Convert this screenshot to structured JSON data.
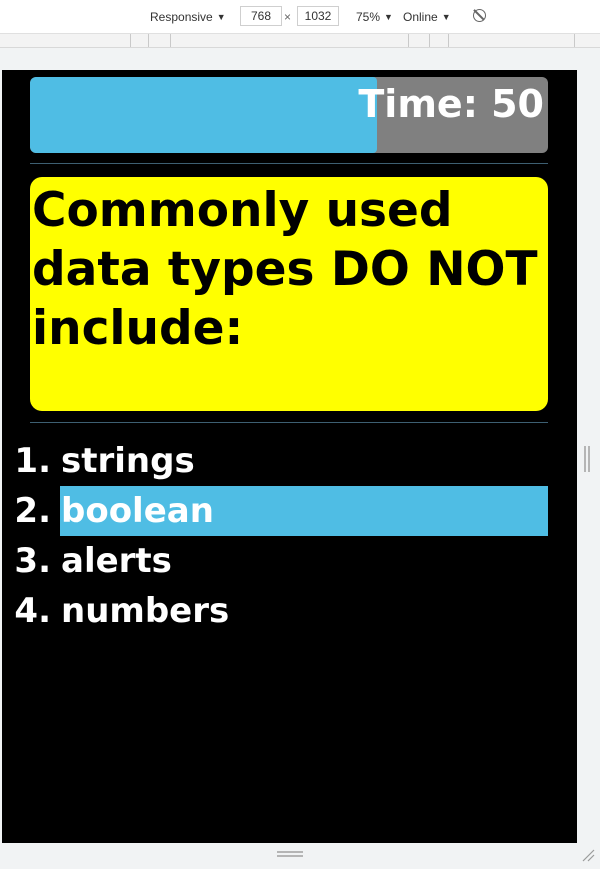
{
  "devtools": {
    "device": "Responsive",
    "width": "768",
    "times": "×",
    "height": "1032",
    "zoom": "75%",
    "network": "Online",
    "caret": "▼"
  },
  "quiz": {
    "timer_label": "Time: 50",
    "timer_progress": 0.67,
    "question": "Commonly used data types DO NOT include:",
    "answers": [
      {
        "number": "1.",
        "text": "strings"
      },
      {
        "number": "2.",
        "text": "boolean"
      },
      {
        "number": "3.",
        "text": "alerts"
      },
      {
        "number": "4.",
        "text": "numbers"
      }
    ],
    "selected_index": 1
  },
  "colors": {
    "timer_fill": "#4fbde4",
    "timer_track": "#808080",
    "question_bg": "#ffff00",
    "highlight": "#4fbde4",
    "page_bg": "#000000"
  }
}
